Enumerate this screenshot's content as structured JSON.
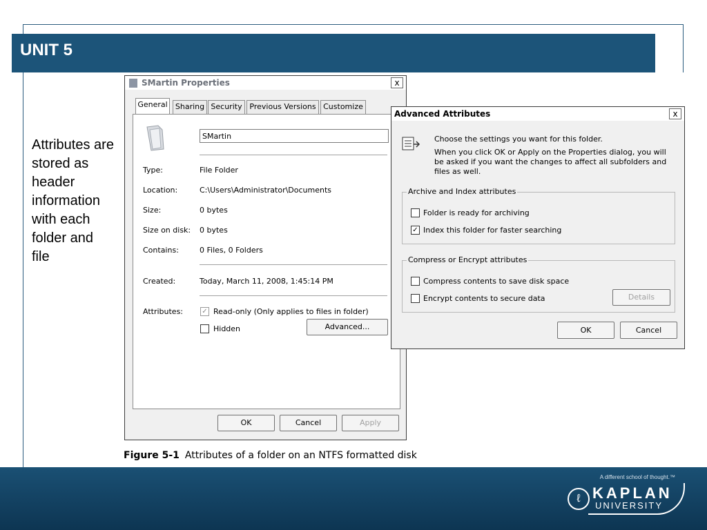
{
  "slide": {
    "unit_title": "UNIT 5",
    "side_text": "Attributes are stored as header information with each folder and file",
    "figure_label": "Figure 5-1",
    "figure_caption": "Attributes of a folder on an NTFS formatted disk"
  },
  "properties_dialog": {
    "title": "SMartin Properties",
    "close": "x",
    "tabs": [
      {
        "label": "General",
        "active": true
      },
      {
        "label": "Sharing",
        "active": false
      },
      {
        "label": "Security",
        "active": false
      },
      {
        "label": "Previous Versions",
        "active": false
      },
      {
        "label": "Customize",
        "active": false
      }
    ],
    "name_value": "SMartin",
    "fields": [
      {
        "label": "Type:",
        "value": "File Folder"
      },
      {
        "label": "Location:",
        "value": "C:\\Users\\Administrator\\Documents"
      },
      {
        "label": "Size:",
        "value": "0 bytes"
      },
      {
        "label": "Size on disk:",
        "value": "0 bytes"
      },
      {
        "label": "Contains:",
        "value": "0 Files, 0 Folders"
      }
    ],
    "created_label": "Created:",
    "created_value": "Today, March 11, 2008, 1:45:14 PM",
    "attributes_label": "Attributes:",
    "readonly_label": "Read-only (Only applies to files in folder)",
    "readonly_checked": true,
    "hidden_label": "Hidden",
    "hidden_checked": false,
    "advanced_button": "Advanced...",
    "ok_button": "OK",
    "cancel_button": "Cancel",
    "apply_button": "Apply"
  },
  "advanced_dialog": {
    "title": "Advanced Attributes",
    "close": "x",
    "intro_1": "Choose the settings you want for this folder.",
    "intro_2": "When you click OK or Apply on the Properties dialog, you will be asked if you want the changes to affect all subfolders and files as well.",
    "archive_group": "Archive and Index attributes",
    "archive_label": "Folder is ready for archiving",
    "archive_checked": false,
    "index_label": "Index this folder for faster searching",
    "index_checked": true,
    "compress_group": "Compress or Encrypt attributes",
    "compress_label": "Compress contents to save disk space",
    "compress_checked": false,
    "encrypt_label": "Encrypt contents to secure data",
    "encrypt_checked": false,
    "details_button": "Details",
    "ok_button": "OK",
    "cancel_button": "Cancel"
  },
  "footer": {
    "tagline": "A different school of thought.™",
    "logo_mark": "ℓ",
    "logo_name": "KAPLAN",
    "logo_sub": "UNIVERSITY"
  },
  "colors": {
    "header_bar": "#1c5479",
    "footer_bar": "#0d3552",
    "frame_line": "#2a5b7e"
  }
}
